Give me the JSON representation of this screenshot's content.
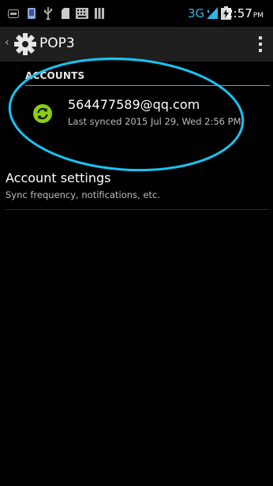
{
  "status_bar": {
    "network_type": "3G",
    "time": "2:57",
    "ampm": "PM",
    "icons": [
      "notification-icon",
      "phone-icon",
      "usb-icon",
      "sd-card-icon",
      "keyboard-icon",
      "bars-icon",
      "signal-icon",
      "battery-icon"
    ]
  },
  "action_bar": {
    "title": "POP3",
    "icon": "gear-icon",
    "menu_icon": "overflow-menu-icon"
  },
  "accounts": {
    "section_title": "ACCOUNTS",
    "items": [
      {
        "email": "564477589@qq.com",
        "subtitle": "Last synced 2015 Jul 29, Wed 2:56 PM",
        "icon": "sync-icon",
        "icon_color": "#8ccd14"
      }
    ]
  },
  "account_settings": {
    "title": "Account settings",
    "subtitle": "Sync frequency, notifications, etc."
  },
  "colors": {
    "accent": "#33b5e5",
    "sync_green": "#8ccd14",
    "background": "#000000"
  }
}
